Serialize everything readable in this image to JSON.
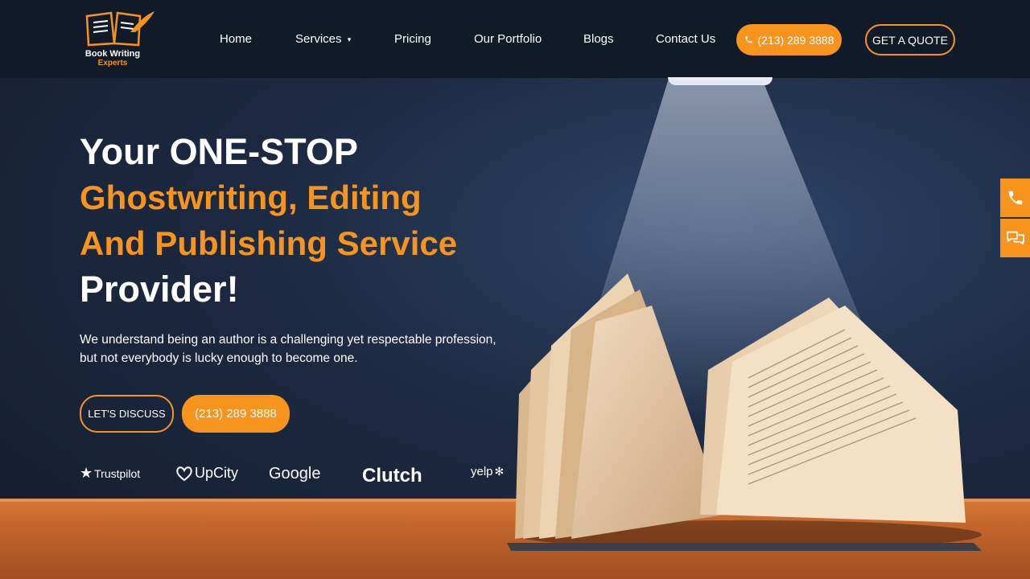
{
  "brand": {
    "name_line1": "Book Writing",
    "name_line2": "Experts"
  },
  "nav": {
    "items": [
      {
        "label": "Home"
      },
      {
        "label": "Services"
      },
      {
        "label": "Pricing"
      },
      {
        "label": "Our Portfolio"
      },
      {
        "label": "Blogs"
      },
      {
        "label": "Contact Us"
      }
    ],
    "phone_label": "(213) 289 3888",
    "quote_label": "GET A QUOTE"
  },
  "hero": {
    "line1": "Your ONE-STOP",
    "line2": "Ghostwriting, Editing",
    "line3": "And Publishing Service",
    "line4": "Provider!",
    "description": "We understand being an author is a challenging yet respectable profession, but not everybody is lucky enough to become one.",
    "discuss_label": "LET'S DISCUSS",
    "phone_label": "(213) 289 3888"
  },
  "review_brands": [
    {
      "name": "Trustpilot"
    },
    {
      "name": "UpCity"
    },
    {
      "name": "Google"
    },
    {
      "name": "Clutch"
    },
    {
      "name": "yelp"
    }
  ],
  "colors": {
    "accent": "#f7941d",
    "navbar_bg": "#111a28",
    "hero_bg": "#1c2a42"
  },
  "icons": {
    "phone": "phone-icon",
    "chat": "chat-icon",
    "dropdown": "chevron-down-icon"
  }
}
